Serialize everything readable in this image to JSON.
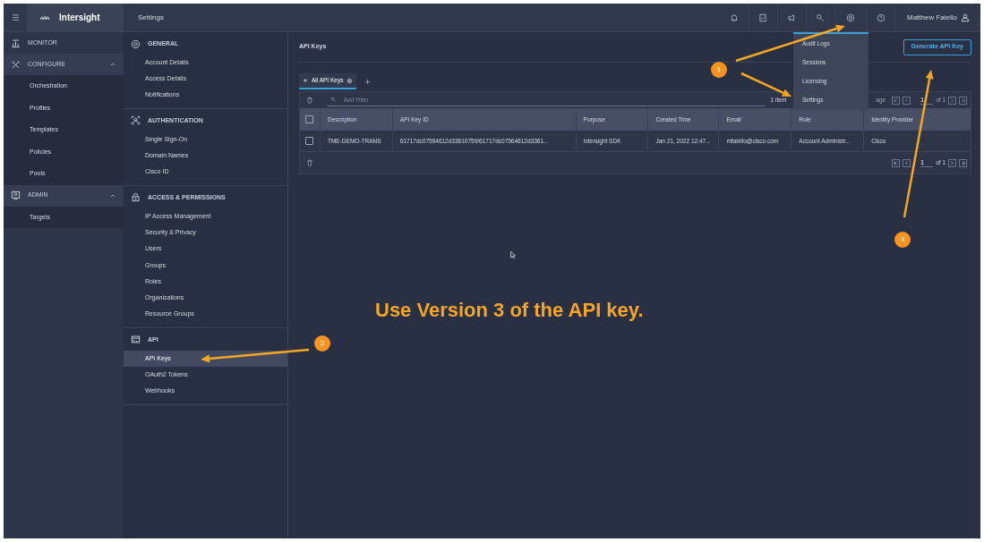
{
  "topbar": {
    "brand": "Intersight",
    "title": "Settings",
    "icons": [
      {
        "kind": "bell"
      },
      {
        "kind": "tasks"
      },
      {
        "kind": "megaphone"
      },
      {
        "kind": "search"
      },
      {
        "kind": "gear"
      },
      {
        "kind": "help"
      }
    ],
    "user": "Matthew Faiello"
  },
  "nav": [
    {
      "label": "MONITOR"
    },
    {
      "label": "CONFIGURE",
      "expanded": true,
      "children": [
        "Orchestration",
        "Profiles",
        "Templates",
        "Policies",
        "Pools"
      ]
    },
    {
      "label": "ADMIN",
      "expanded": true,
      "children": [
        "Targets"
      ]
    }
  ],
  "settings": [
    {
      "title": "GENERAL",
      "items": [
        {
          "label": "Account Details",
          "selected": false
        },
        {
          "label": "Access Details",
          "selected": false
        },
        {
          "label": "Notifications",
          "selected": false
        }
      ]
    },
    {
      "title": "AUTHENTICATION",
      "items": [
        {
          "label": "Single Sign-On",
          "selected": false
        },
        {
          "label": "Domain Names",
          "selected": false
        },
        {
          "label": "Cisco ID",
          "selected": false
        }
      ]
    },
    {
      "title": "ACCESS & PERMISSIONS",
      "items": [
        {
          "label": "IP Access Management",
          "selected": false
        },
        {
          "label": "Security & Privacy",
          "selected": false
        },
        {
          "label": "Users",
          "selected": false
        },
        {
          "label": "Groups",
          "selected": false
        },
        {
          "label": "Roles",
          "selected": false
        },
        {
          "label": "Organizations",
          "selected": false
        },
        {
          "label": "Resource Groups",
          "selected": false
        }
      ]
    },
    {
      "title": "API",
      "items": [
        {
          "label": "API Keys",
          "selected": true
        },
        {
          "label": "OAuth2 Tokens",
          "selected": false
        },
        {
          "label": "Webhooks",
          "selected": false
        }
      ]
    }
  ],
  "main": {
    "title": "API Keys",
    "button": "Generate API Key",
    "tabs": [
      {
        "label": "All API Keys",
        "selected": true
      }
    ],
    "filter": {
      "placeholder": "Add Filter"
    },
    "items_text": "1 item",
    "per_page_text": "age",
    "page": "1",
    "of_pages": "of 1",
    "select_all_checked": false,
    "columns": [
      "Description",
      "API Key ID",
      "Purpose",
      "Created Time",
      "Email",
      "Role",
      "Identity Provider"
    ],
    "rows": [
      {
        "checked": false,
        "cells": [
          "TME-DEMO-TRANS",
          "61717dc07564612d33610759/61717dc07564612d3361...",
          "Intersight SDK",
          "Jan 21, 2022 12:47...",
          "mfaiello@cisco.com",
          "Account Administr...",
          "Cisco"
        ]
      }
    ],
    "footer_page": "1",
    "footer_of_pages": "of 1"
  },
  "menu": {
    "items": [
      "Audit Logs",
      "Sessions",
      "Licensing",
      "Settings"
    ]
  },
  "annotations": [
    {
      "label": "1"
    },
    {
      "label": "2"
    },
    {
      "label": "3"
    }
  ],
  "caption": "Use Version 3 of the API key."
}
